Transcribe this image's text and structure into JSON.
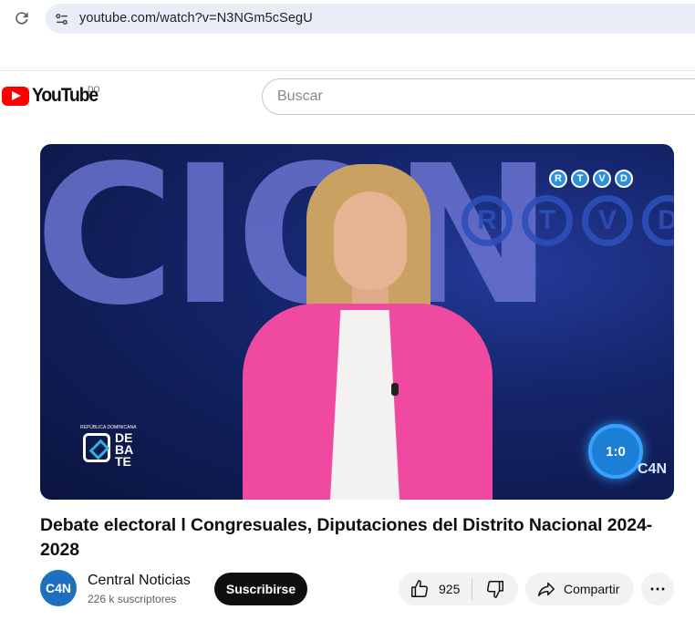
{
  "browser": {
    "url": "youtube.com/watch?v=N3NGm5cSegU"
  },
  "header": {
    "logo_text": "YouTube",
    "country_code": "DO",
    "search_placeholder": "Buscar"
  },
  "video": {
    "bg_text": "CION",
    "rtvd_letters": [
      "R",
      "T",
      "V",
      "D"
    ],
    "timer": "1:0",
    "watermark": "C4N",
    "debate_logo_caption": "REPÚBLICA DOMINICANA",
    "debate_logo_word": "DE BA TE"
  },
  "meta": {
    "title": "Debate electoral l Congresuales, Diputaciones del Distrito Nacional 2024-2028",
    "channel_avatar": "C4N",
    "channel_name": "Central Noticias",
    "subscribers": "226 k suscriptores",
    "subscribe_label": "Suscribirse",
    "like_count": "925",
    "share_label": "Compartir",
    "more_label": "⋯"
  },
  "colors": {
    "brand_red": "#ff0000",
    "blazer_pink": "#f04aa0",
    "studio_blue": "#142468"
  }
}
